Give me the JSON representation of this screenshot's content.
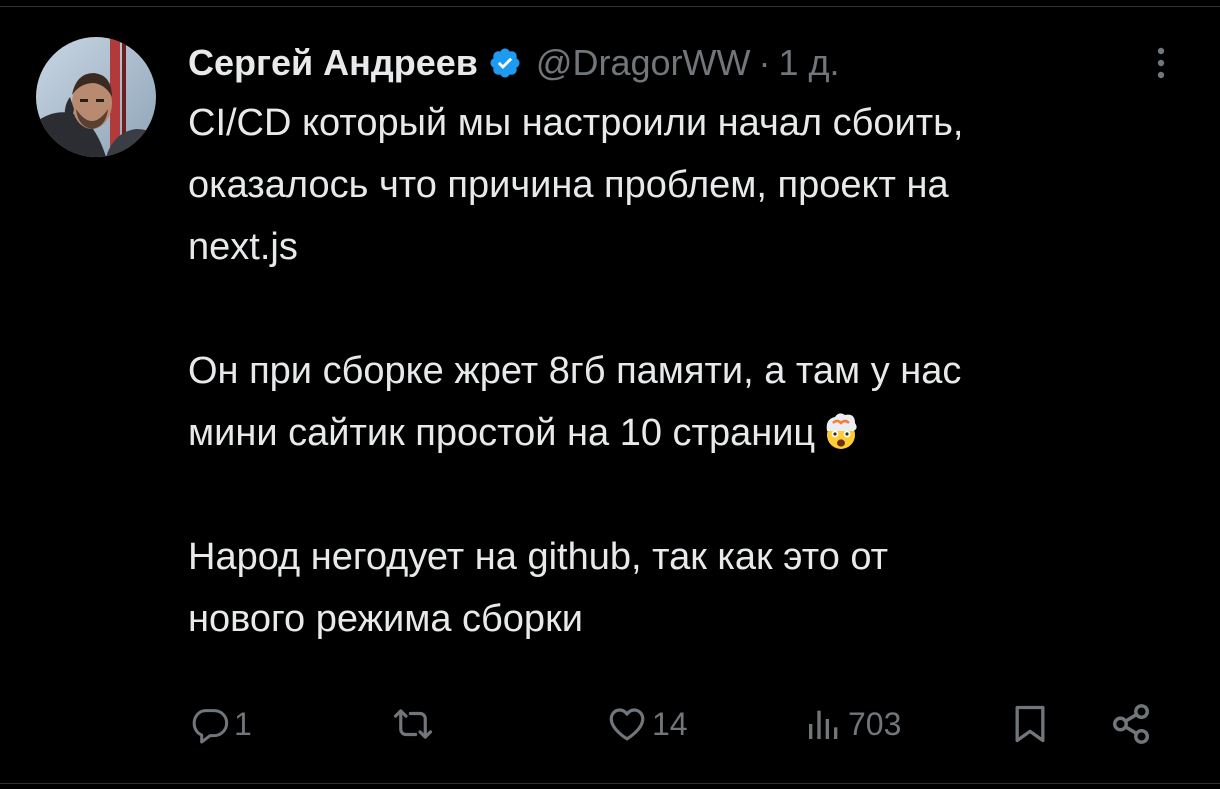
{
  "author": {
    "display_name": "Сергей Андреев",
    "handle": "@DragorWW",
    "separator": "·",
    "time": "1 д.",
    "verified": true,
    "verified_color": "#1d9bf0"
  },
  "icons": {
    "more": "more-dots-icon",
    "verified": "verified-badge-icon",
    "emoji": "exploding-head-emoji"
  },
  "body": {
    "line1": "CI/CD который мы настроили начал сбоить,",
    "line2": "оказалось что причина проблем, проект на",
    "line3": "next.js",
    "line4": "Он при сборке жрет 8гб памяти, а там у нас",
    "line5": "мини сайтик простой на 10 страниц",
    "line6": "Народ  негодует на github, так как это от",
    "line7": "нового режима сборки"
  },
  "actions": {
    "reply": {
      "icon": "reply-icon",
      "count": "1"
    },
    "retweet": {
      "icon": "retweet-icon",
      "count": ""
    },
    "like": {
      "icon": "heart-icon",
      "count": "14"
    },
    "views": {
      "icon": "views-chart-icon",
      "count": "703"
    },
    "bookmark": {
      "icon": "bookmark-icon"
    },
    "share": {
      "icon": "share-icon"
    }
  },
  "colors": {
    "background": "#000000",
    "text": "#e7e9ea",
    "muted": "#71767b",
    "divider": "#2f3336"
  }
}
